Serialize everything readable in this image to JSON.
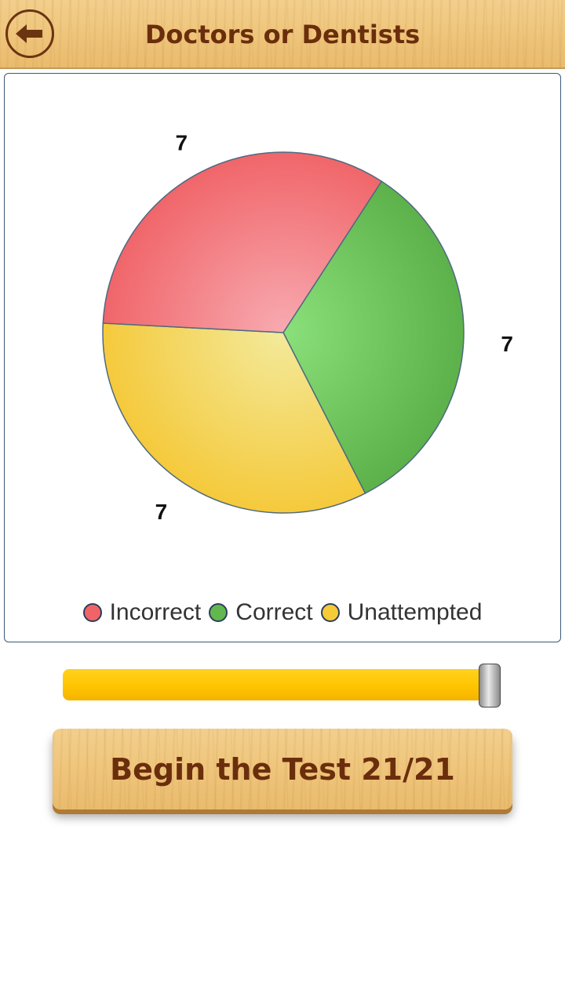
{
  "header": {
    "title": "Doctors or Dentists",
    "back_icon": "back-arrow-icon"
  },
  "chart_data": {
    "type": "pie",
    "slices": [
      {
        "label": "Incorrect",
        "value": 7,
        "color": "#f06468"
      },
      {
        "label": "Correct",
        "value": 7,
        "color": "#62b84e"
      },
      {
        "label": "Unattempted",
        "value": 7,
        "color": "#f5cb38"
      }
    ],
    "legend_position": "bottom"
  },
  "legend": {
    "items": [
      {
        "label": "Incorrect",
        "color": "#f06468"
      },
      {
        "label": "Correct",
        "color": "#62b84e"
      },
      {
        "label": "Unattempted",
        "color": "#f5cb38"
      }
    ]
  },
  "slider": {
    "fraction": 1.0
  },
  "action": {
    "begin_label": "Begin the Test 21/21"
  }
}
